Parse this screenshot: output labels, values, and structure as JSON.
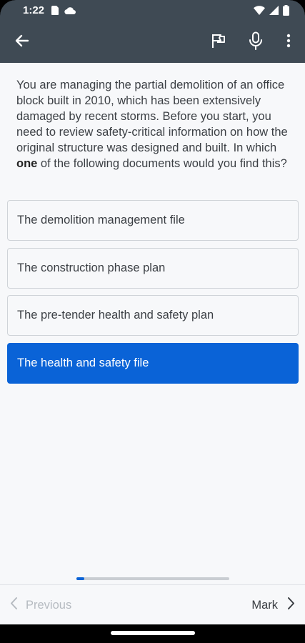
{
  "status_bar": {
    "time": "1:22",
    "left_icons": [
      "sim-card-icon",
      "cloud-icon"
    ],
    "right_icons": [
      "wifi-icon",
      "signal-icon",
      "battery-icon"
    ]
  },
  "app_bar": {
    "back_icon": "back-arrow-icon",
    "actions": [
      "flag-icon",
      "microphone-icon",
      "more-vert-icon"
    ]
  },
  "question": {
    "text_before_bold": "You are managing the partial demolition of an office block built in 2010, which has been extensively damaged by recent storms. Before you start, you need to review safety-critical information on how the original structure was designed and built. In which ",
    "bold_word": "one",
    "text_after_bold": " of the following documents would you find this?"
  },
  "options": [
    {
      "label": "The demolition management file",
      "selected": false
    },
    {
      "label": "The construction phase plan",
      "selected": false
    },
    {
      "label": "The pre-tender health and safety plan",
      "selected": false
    },
    {
      "label": "The health and safety file",
      "selected": true
    }
  ],
  "progress": {
    "fraction": 0.05
  },
  "bottom_nav": {
    "previous_label": "Previous",
    "next_label": "Mark",
    "previous_enabled": false
  },
  "colors": {
    "app_bar": "#3f4a54",
    "accent": "#0a63d7",
    "background": "#f7f8fa"
  }
}
